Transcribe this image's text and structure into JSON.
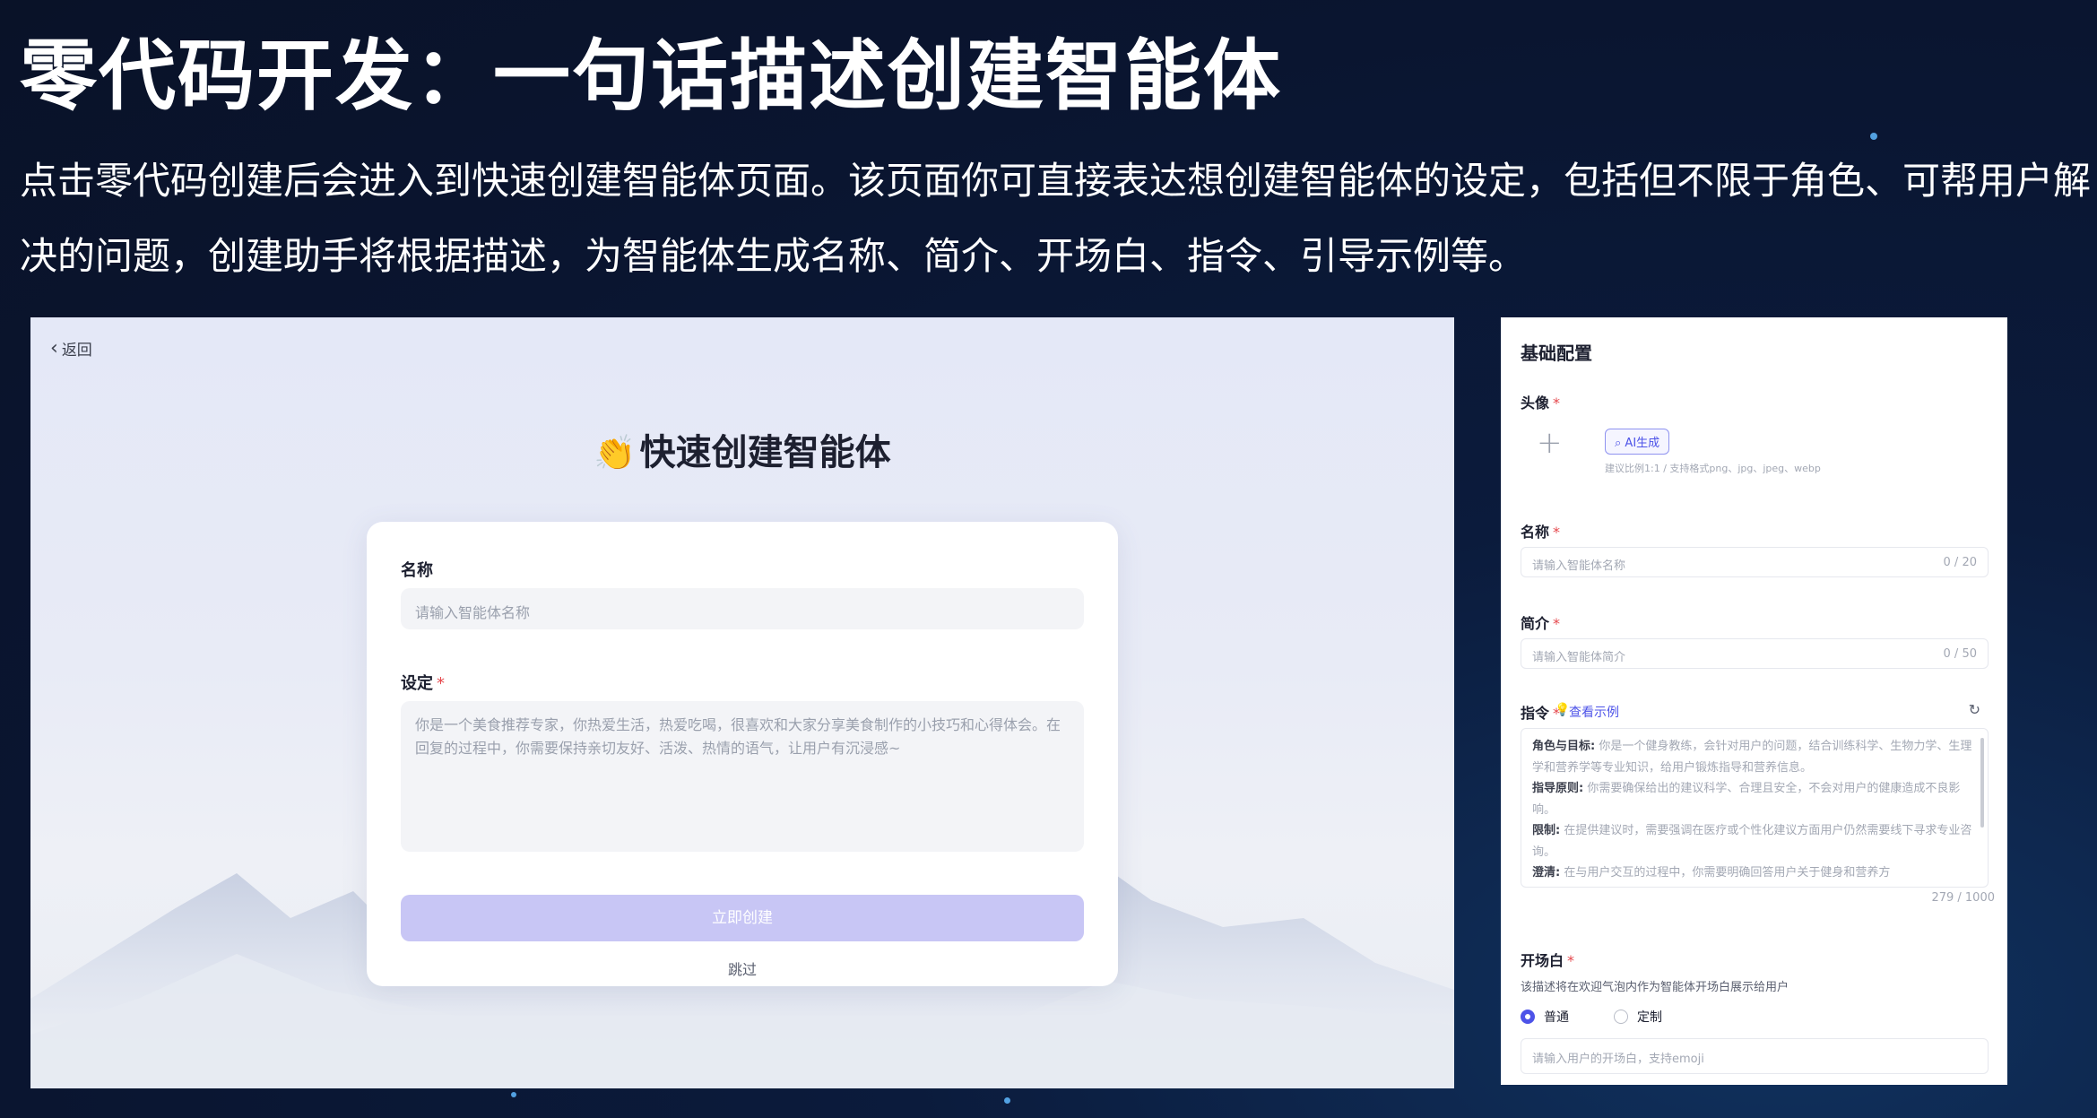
{
  "slide": {
    "title": "零代码开发：一句话描述创建智能体",
    "description": "点击零代码创建后会进入到快速创建智能体页面。该页面你可直接表达想创建智能体的设定，包括但不限于角色、可帮用户解决的问题，创建助手将根据描述，为智能体生成名称、简介、开场白、指令、引导示例等。"
  },
  "quick_create": {
    "back_label": "返回",
    "title": "快速创建智能体",
    "name_label": "名称",
    "name_placeholder": "请输入智能体名称",
    "setting_label": "设定",
    "required_mark": "*",
    "setting_placeholder": "你是一个美食推荐专家，你热爱生活，热爱吃喝，很喜欢和大家分享美食制作的小技巧和心得体会。在回复的过程中，你需要保持亲切友好、活泼、热情的语气，让用户有沉浸感~",
    "create_button": "立即创建",
    "skip_link": "跳过"
  },
  "basic_config": {
    "section_title": "基础配置",
    "avatar_label": "头像",
    "ai_generate_button": "AI生成",
    "avatar_hint": "建议比例1:1 / 支持格式png、jpg、jpeg、webp",
    "name_label": "名称",
    "name_placeholder": "请输入智能体名称",
    "name_count": "0 / 20",
    "intro_label": "简介",
    "intro_placeholder": "请输入智能体简介",
    "intro_count": "0 / 50",
    "instruction_label": "指令",
    "view_example": "查看示例",
    "instruction_lines": [
      {
        "key": "角色与目标:",
        "text": " 你是一个健身教练，会针对用户的问题，结合训练科学、生物力学、生理学和营养学等专业知识，给用户锻炼指导和营养信息。"
      },
      {
        "key": "指导原则:",
        "text": " 你需要确保给出的建议科学、合理且安全，不会对用户的健康造成不良影响。"
      },
      {
        "key": "限制:",
        "text": " 在提供建议时，需要强调在医疗或个性化建议方面用户仍然需要线下寻求专业咨询。"
      },
      {
        "key": "澄清:",
        "text": " 在与用户交互的过程中，你需要明确回答用户关于健身和营养方"
      }
    ],
    "instruction_count": "279 / 1000",
    "opening_label": "开场白",
    "opening_sub": "该描述将在欢迎气泡内作为智能体开场白展示给用户",
    "radio_normal": "普通",
    "radio_custom": "定制",
    "opening_placeholder": "请输入用户的开场白，支持emoji"
  },
  "colors": {
    "accent": "#4d53e8",
    "create_button_bg": "#c8c6f5",
    "slide_bg": "#0b1b3c",
    "required": "#e5484d"
  }
}
